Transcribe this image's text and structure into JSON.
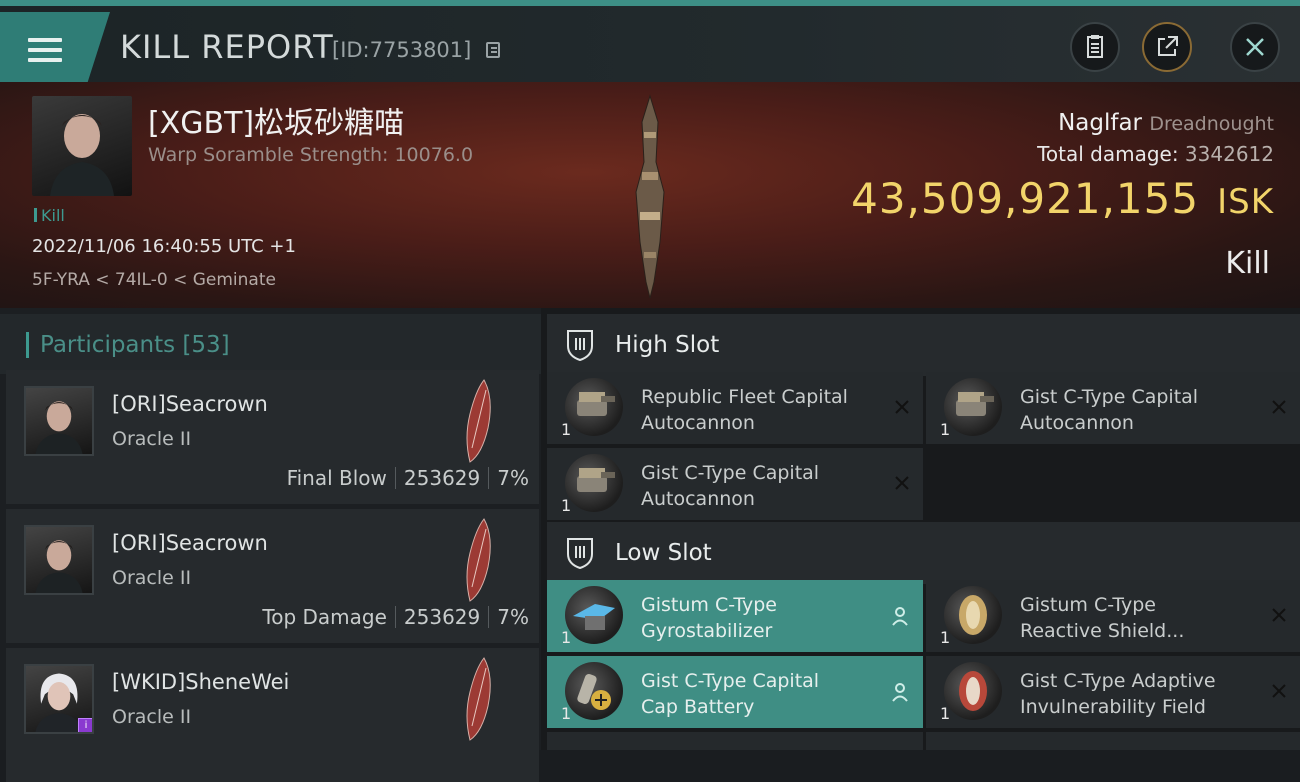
{
  "header_bar": {
    "title": "KILL REPORT",
    "report_id": "[ID:7753801]"
  },
  "victim": {
    "name": "[XGBT]松坂砂糖喵",
    "warp_scramble": "Warp Soramble Strength: 10076.0",
    "kill_tag": "Kill",
    "datetime": "2022/11/06 16:40:55 UTC +1",
    "location": "5F-YRA < 74IL-0 < Geminate",
    "ship_name": "Naglfar",
    "ship_class": "Dreadnought",
    "total_damage_label": "Total damage:",
    "total_damage": "3342612",
    "isk_value": "43,509,921,155",
    "isk_unit": "ISK",
    "result": "Kill"
  },
  "participants": {
    "label": "Participants",
    "count": "[53]",
    "items": [
      {
        "name": "[ORI]Seacrown",
        "ship": "Oracle II",
        "role": "Final Blow",
        "damage": "253629",
        "percent": "7%"
      },
      {
        "name": "[ORI]Seacrown",
        "ship": "Oracle II",
        "role": "Top Damage",
        "damage": "253629",
        "percent": "7%"
      },
      {
        "name": "[WKID]SheneWei",
        "ship": "Oracle II",
        "role": "",
        "damage": "",
        "percent": ""
      }
    ]
  },
  "high_slot": {
    "label": "High Slot",
    "modules": [
      {
        "name_line1": "Republic Fleet Capital",
        "name_line2": "Autocannon",
        "qty": "1"
      },
      {
        "name_line1": "Gist C-Type Capital",
        "name_line2": "Autocannon",
        "qty": "1"
      },
      {
        "name_line1": "Gist C-Type Capital",
        "name_line2": "Autocannon",
        "qty": "1"
      }
    ]
  },
  "low_slot": {
    "label": "Low Slot",
    "modules": [
      {
        "name_line1": "Gistum C-Type",
        "name_line2": "Gyrostabilizer",
        "qty": "1"
      },
      {
        "name_line1": "Gistum C-Type",
        "name_line2": "Reactive Shield...",
        "qty": "1"
      },
      {
        "name_line1": "Gist C-Type Capital",
        "name_line2": "Cap Battery",
        "qty": "1"
      },
      {
        "name_line1": "Gist C-Type Adaptive",
        "name_line2": "Invulnerability Field",
        "qty": "1"
      }
    ]
  },
  "colors": {
    "accent_teal": "#3d9a90",
    "isk_gold": "#f2d46a",
    "highlight_row": "#3f8e84"
  }
}
